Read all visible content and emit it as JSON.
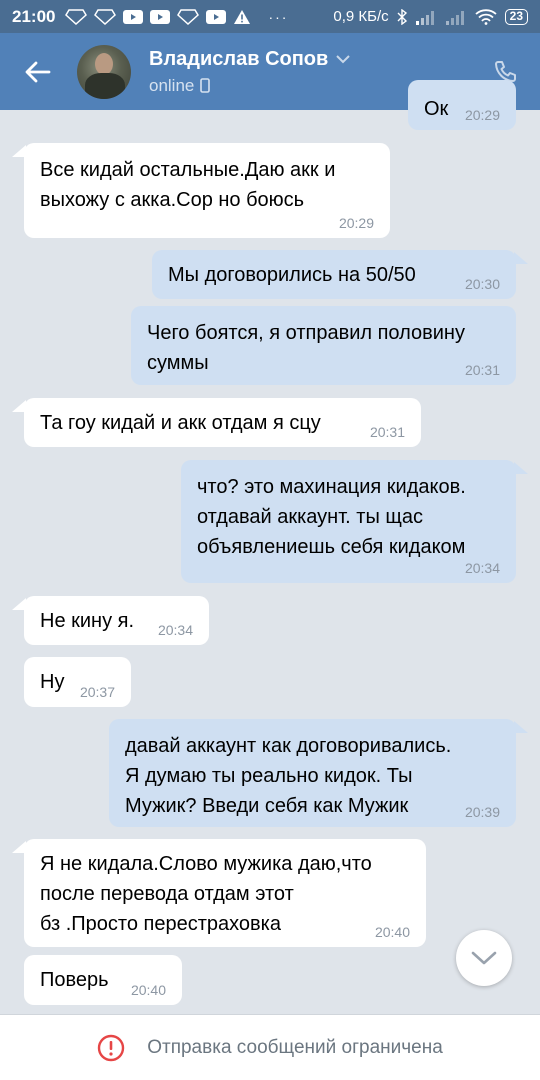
{
  "status_bar": {
    "time": "21:00",
    "speed": "0,9 КБ/с",
    "battery": "23"
  },
  "header": {
    "name": "Владислав Сопов",
    "status": "online",
    "back_icon": "arrow-left-icon",
    "phone_icon": "phone-icon"
  },
  "messages": [
    {
      "dir": "out",
      "text": "Ок",
      "time": "20:29"
    },
    {
      "dir": "in",
      "line1": "Все кидай остальные.Даю акк и",
      "line2": "выхожу с акка.Сор но боюсь",
      "time": "20:29"
    },
    {
      "dir": "out",
      "text": "Мы договорились на 50/50",
      "time": "20:30"
    },
    {
      "dir": "out",
      "line1": "Чего боятся, я отправил половину",
      "line2": "суммы",
      "time": "20:31"
    },
    {
      "dir": "in",
      "text": "Та гоу кидай и акк отдам я сцу",
      "time": "20:31"
    },
    {
      "dir": "out",
      "line1": "что? это махинация кидаков.",
      "line2": "отдавай аккаунт. ты щас",
      "line3": "объявлениешь себя кидаком",
      "time": "20:34"
    },
    {
      "dir": "in",
      "text": "Не кину я.",
      "time": "20:34"
    },
    {
      "dir": "in",
      "text": "Ну",
      "time": "20:37"
    },
    {
      "dir": "out",
      "line1": "давай аккаунт как договоривались.",
      "line2": "Я думаю ты реально кидок. Ты",
      "line3": "Мужик? Введи себя как Мужик",
      "time": "20:39"
    },
    {
      "dir": "in",
      "line1": "Я не кидала.Слово мужика даю,что",
      "line2": "после перевода отдам этот",
      "line3": "бз .Просто перестраховка",
      "time": "20:40"
    },
    {
      "dir": "in",
      "text": "Поверь",
      "time": "20:40"
    }
  ],
  "bottom_bar": {
    "text": "Отправка сообщений ограничена",
    "icon": "alert-circle-icon",
    "accent": "#e64646"
  },
  "colors": {
    "header": "#5181b8",
    "status_bar": "#4a6d92",
    "background": "#dfe4ea",
    "outgoing": "#cfdff2",
    "incoming": "#ffffff"
  }
}
